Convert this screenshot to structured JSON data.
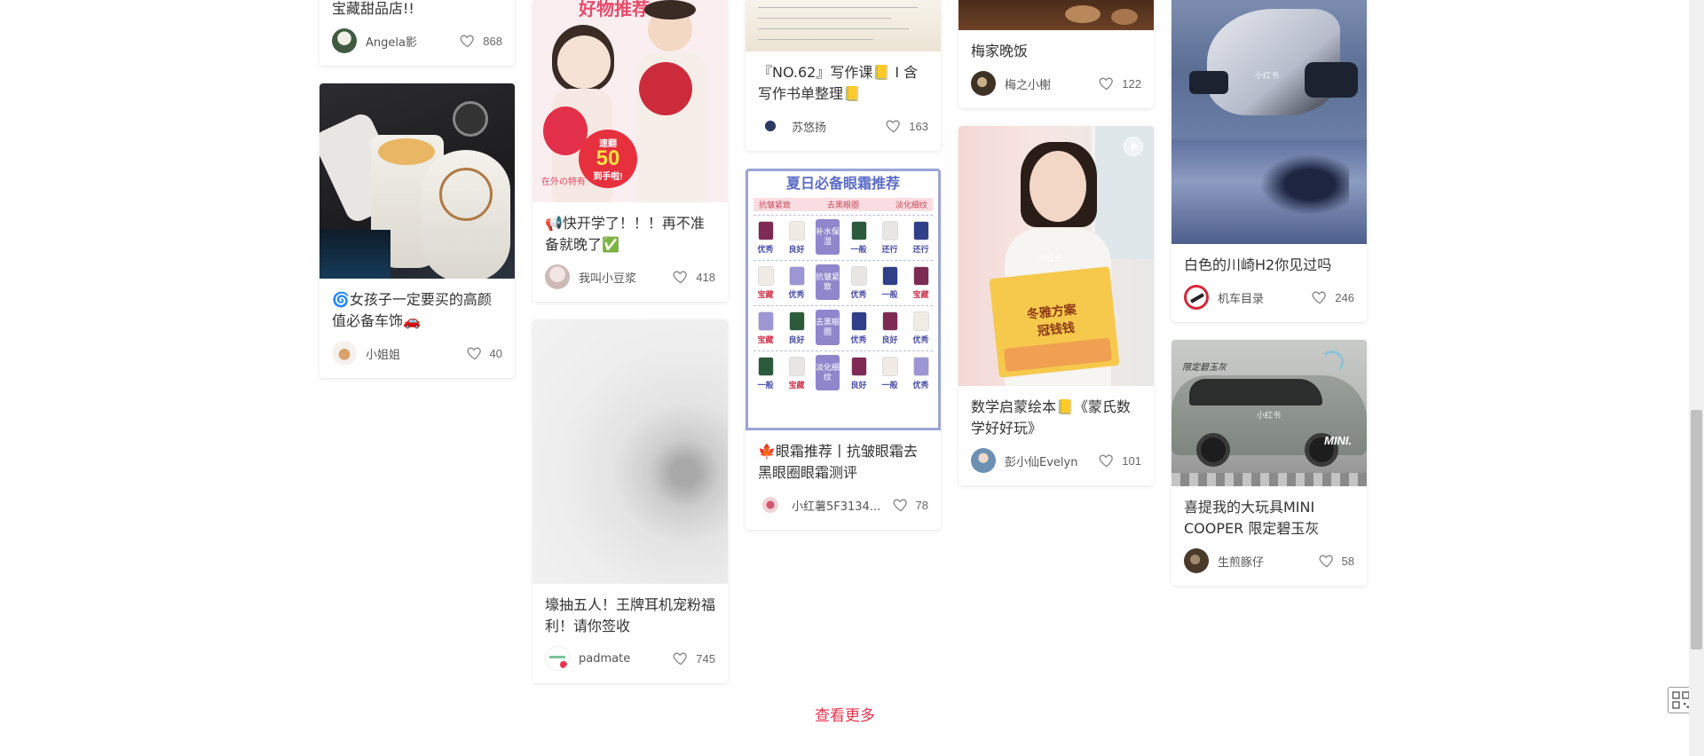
{
  "cards": [
    {
      "title": "宝藏甜品店!!",
      "author": "Angela影",
      "likes": "868"
    },
    {
      "title": "🌀女孩子一定要买的高颜值必备车饰🚗",
      "author": "小姐姐",
      "likes": "40"
    },
    {
      "title": "📢快开学了！！！再不准备就晚了✅",
      "author": "我叫小豆浆",
      "likes": "418"
    },
    {
      "title": "壕抽五人！王牌耳机宠粉福利！请你签收",
      "author": "padmate",
      "likes": "745"
    },
    {
      "title": "『NO.62』写作课📒 I 含写作书单整理📒",
      "author": "苏悠扬",
      "likes": "163"
    },
    {
      "title": "🍁眼霜推荐丨抗皱眼霜去黑眼圈眼霜测评",
      "author": "小红薯5F3134...",
      "likes": "78"
    },
    {
      "title": "梅家晚饭",
      "author": "梅之小榭",
      "likes": "122"
    },
    {
      "title": "数学启蒙绘本📒《蒙氏数学好好玩》",
      "author": "彭小仙Evelyn",
      "likes": "101"
    },
    {
      "title": "白色的川崎H2你见过吗",
      "author": "机车目录",
      "likes": "246"
    },
    {
      "title": "喜提我的大玩具MINI COOPER 限定碧玉灰",
      "author": "生煎豚仔",
      "likes": "58"
    }
  ],
  "eye_cream_image": {
    "header": "夏日必备眼霜推荐",
    "sub": [
      "抗皱紧致",
      "去黑眼圈",
      "淡化细纹"
    ],
    "rows": [
      [
        "优秀",
        "良好",
        "补水保湿",
        "一般",
        "还行",
        "还行"
      ],
      [
        "宝藏",
        "优秀",
        "抗皱紧致",
        "优秀",
        "一般",
        "宝藏"
      ],
      [
        "宝藏",
        "良好",
        "去黑眼圈",
        "优秀",
        "良好",
        "优秀"
      ],
      [
        "一般",
        "宝藏",
        "淡化细纹",
        "良好",
        "一般",
        "优秀"
      ]
    ]
  },
  "kids_image": {
    "top": "好物推荐",
    "badge_big": "50",
    "badge_sub": "速翻",
    "badge_sub2": "到手啦!",
    "tag": "在外の特有"
  },
  "book_image": {
    "title": "冬雅方案",
    "line2": "冠钱钱"
  },
  "car_image": {
    "banner": "限定碧玉灰",
    "brand": "MINI."
  },
  "watermark": "小红书",
  "load_more": "查看更多",
  "colors": {
    "accent": "#e8344e"
  }
}
